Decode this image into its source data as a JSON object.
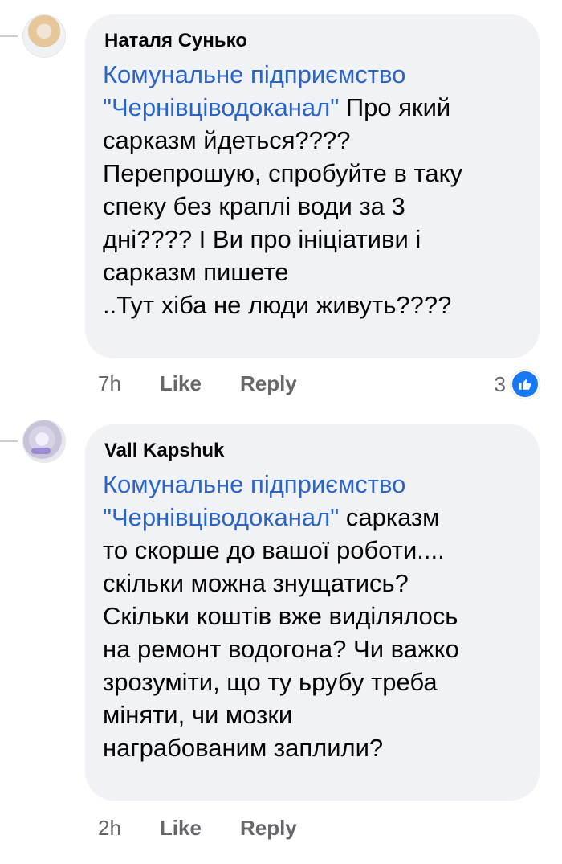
{
  "comments": [
    {
      "author": "Наталя Сунько",
      "mention_line1": "Комунальне підприємство",
      "mention_line2": "\"Чернівціводоканал\"",
      "text_after_mention": "Про який",
      "lines": [
        "сарказм йдеться????",
        "Перепрошую, спробуйте в таку",
        "спеку без краплі води за 3",
        "дні???? І Ви про ініціативи і",
        "сарказм пишете",
        "..Тут хіба не люди живуть????"
      ],
      "time": "7h",
      "like_label": "Like",
      "reply_label": "Reply",
      "reaction_count": "3",
      "reaction_icon": "thumbs-up-icon",
      "reaction_color": "#1877f2"
    },
    {
      "author": "Vall Kapshuk",
      "mention_line1": "Комунальне підприємство",
      "mention_line2": "\"Чернівціводоканал\"",
      "text_after_mention": "сарказм",
      "lines": [
        "то скорше до вашої роботи....",
        "скільки можна знущатись?",
        "Скільки коштів вже виділялось",
        "на ремонт водогона? Чи важко",
        "зрозуміти, що ту ьрубу треба",
        "міняти, чи мозки",
        "награбованим заплили?"
      ],
      "time": "2h",
      "like_label": "Like",
      "reply_label": "Reply"
    }
  ],
  "colors": {
    "mention": "#2a64c9",
    "bubble": "#f0f2f5",
    "meta": "#65676b"
  }
}
